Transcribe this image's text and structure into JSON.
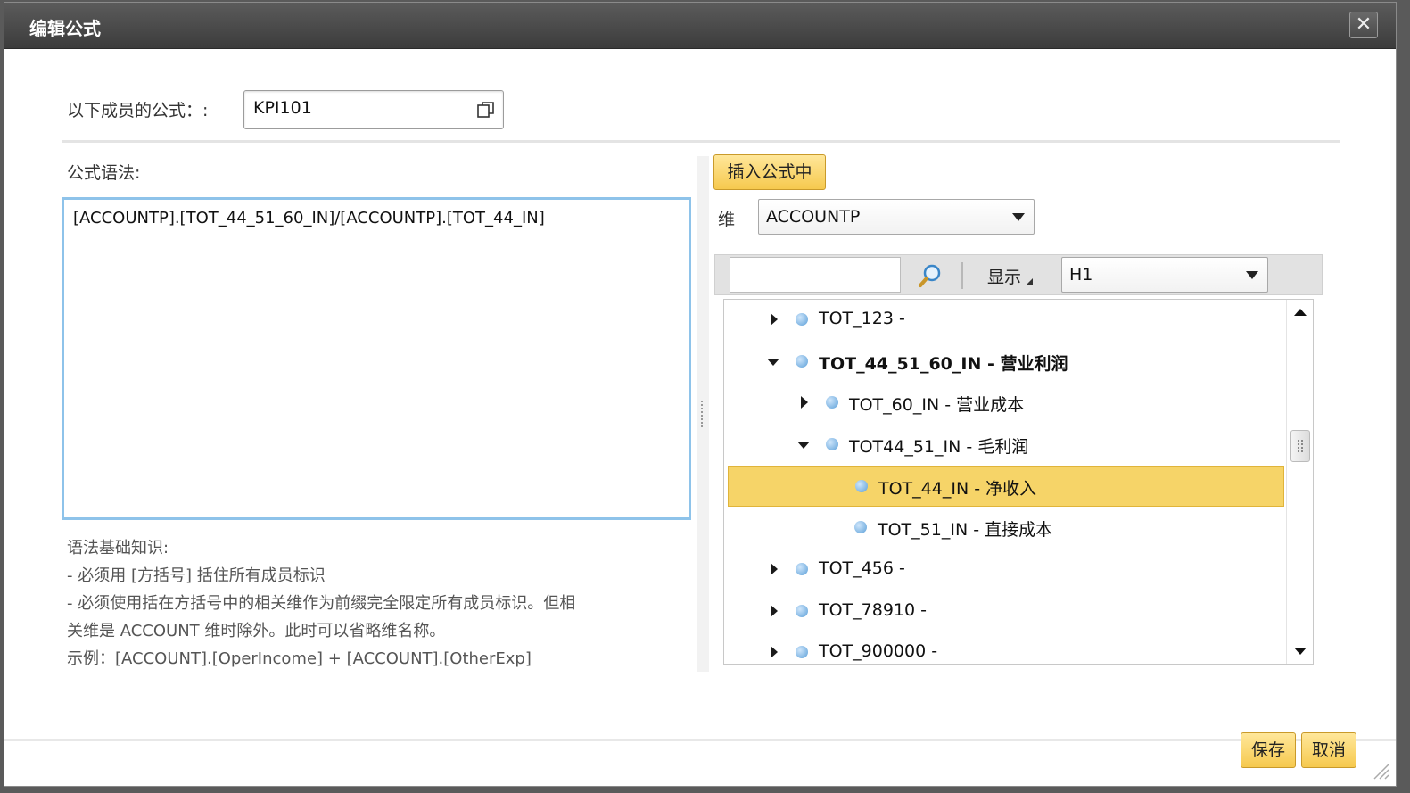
{
  "dialog": {
    "title": "编辑公式",
    "close_icon": "close-icon"
  },
  "member": {
    "label": "以下成员的公式：:",
    "value": "KPI101",
    "copy_icon": "copy-icon"
  },
  "syntax": {
    "label": "公式语法:",
    "formula": "[ACCOUNTP].[TOT_44_51_60_IN]/[ACCOUNTP].[TOT_44_IN]"
  },
  "help": {
    "lines": [
      "语法基础知识:",
      " - 必须用 [方括号] 括住所有成员标识",
      " - 必须使用括在方括号中的相关维作为前缀完全限定所有成员标识。但相",
      "关维是 ACCOUNT 维时除外。此时可以省略维名称。",
      "示例：[ACCOUNT].[OperIncome] + [ACCOUNT].[OtherExp]"
    ]
  },
  "panel": {
    "insert_button": "插入公式中",
    "dimension_label": "维",
    "dimension_value": "ACCOUNTP",
    "search_placeholder": "",
    "show_label": "显示",
    "hierarchy_value": "H1"
  },
  "tree": {
    "items": [
      {
        "text": "TOT_123 -",
        "level": 0,
        "state": "collapsed",
        "bold": false,
        "selected": false
      },
      {
        "text": "TOT_44_51_60_IN - 营业利润",
        "level": 0,
        "state": "expanded",
        "bold": true,
        "selected": false
      },
      {
        "text": "TOT_60_IN - 营业成本",
        "level": 1,
        "state": "collapsed",
        "bold": false,
        "selected": false
      },
      {
        "text": "TOT44_51_IN - 毛利润",
        "level": 1,
        "state": "expanded",
        "bold": false,
        "selected": false
      },
      {
        "text": "TOT_44_IN - 净收入",
        "level": 2,
        "state": "leaf",
        "bold": false,
        "selected": true
      },
      {
        "text": "TOT_51_IN - 直接成本",
        "level": 2,
        "state": "leaf",
        "bold": false,
        "selected": false
      },
      {
        "text": "TOT_456 -",
        "level": 0,
        "state": "collapsed",
        "bold": false,
        "selected": false
      },
      {
        "text": "TOT_78910 -",
        "level": 0,
        "state": "collapsed",
        "bold": false,
        "selected": false
      },
      {
        "text": "TOT_900000 -",
        "level": 0,
        "state": "collapsed",
        "bold": false,
        "selected": false
      }
    ]
  },
  "footer": {
    "save_label": "保存",
    "cancel_label": "取消"
  },
  "colors": {
    "titlebar": "#4a4a4a",
    "accent_button": "#f6c94e",
    "selection": "#f6d468",
    "formula_border": "#8ec3ea",
    "node_dot": "#5b9fd8"
  }
}
